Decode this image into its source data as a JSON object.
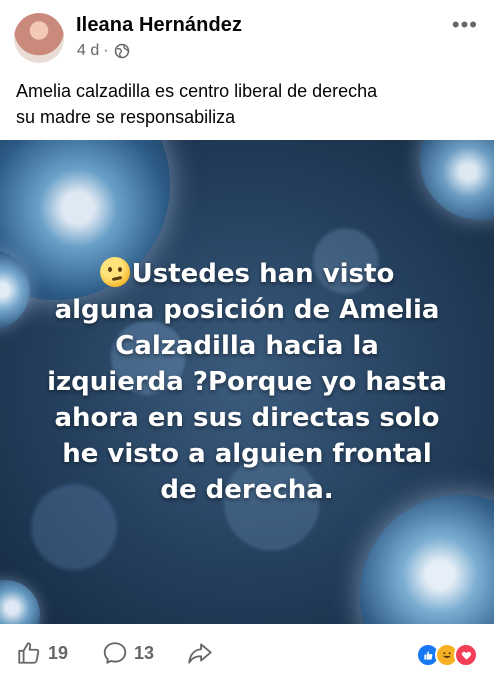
{
  "post": {
    "author": "Ileana Hernández",
    "time": "4 d",
    "separator": "·",
    "privacy_icon": "globe-icon",
    "more_label": "•••",
    "caption_line1": "Amelia calzadilla es centro liberal de derecha",
    "caption_line2": "su madre se responsabiliza"
  },
  "image_text": {
    "emoji": "thinking-face-emoji",
    "line1": "Ustedes han visto",
    "line2": "alguna posición de Amelia",
    "line3": "Calzadilla hacia la",
    "line4": "izquierda ?Porque yo hasta",
    "line5": "ahora en sus directas solo",
    "line6": "he visto a alguien frontal",
    "line7": "de derecha."
  },
  "footer": {
    "likes_count": "19",
    "comments_count": "13",
    "like_icon": "thumbs-up-icon",
    "comment_icon": "comment-bubble-icon",
    "share_icon": "share-arrow-icon",
    "reaction_icons": [
      "like-reaction-icon",
      "haha-reaction-icon",
      "love-reaction-icon"
    ]
  },
  "colors": {
    "text_primary": "#050505",
    "text_secondary": "#65676b",
    "like_blue": "#1877f2",
    "love_red": "#f33e58",
    "haha_yellow": "#f7b125"
  }
}
